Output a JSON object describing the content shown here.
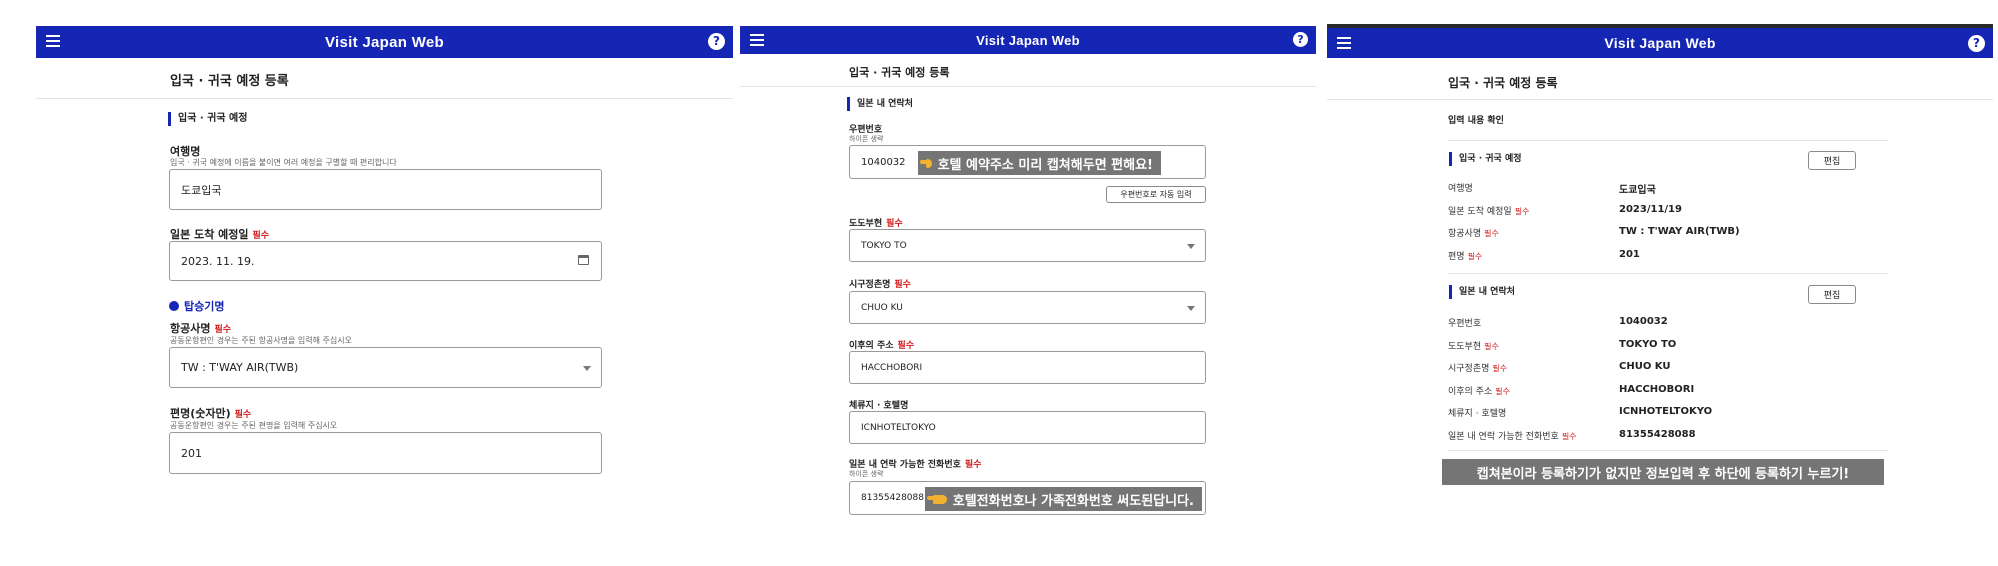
{
  "app_title": "Visit Japan Web",
  "page_title": "입국 · 귀국 예정 등록",
  "required_label": "필수",
  "screen1": {
    "section_title": "입국 · 귀국 예정",
    "trip_name": {
      "label": "여행명",
      "hint": "입국 · 귀국 예정에 이름을 붙이면 여러 예정을 구별할 때 편리합니다",
      "value": "도쿄입국"
    },
    "arrival_date": {
      "label": "일본 도착 예정일",
      "value": "2023. 11. 19."
    },
    "flight_section": "탑승기명",
    "airline": {
      "label": "항공사명",
      "hint": "공동운항편인 경우는 주된 항공사명을 입력해 주십시오",
      "value": "TW : T'WAY AIR(TWB)"
    },
    "flight_no": {
      "label": "편명(숫자만)",
      "hint": "공동운항편인 경우는 주된 편명을 입력해 주십시오",
      "value": "201"
    }
  },
  "screen2": {
    "section_title": "일본 내 연락처",
    "postal": {
      "label": "우편번호",
      "hint": "하이픈 생략",
      "value": "1040032"
    },
    "postal_callout": "호텔 예약주소 미리 캡쳐해두면 편해요!",
    "auto_input_button": "우편번호로 자동 입력",
    "prefecture": {
      "label": "도도부현",
      "value": "TOKYO TO"
    },
    "city": {
      "label": "시구정촌명",
      "value": "CHUO KU"
    },
    "address": {
      "label": "이후의 주소",
      "value": "HACCHOBORI"
    },
    "hotel": {
      "label": "체류지 · 호텔명",
      "value": "ICNHOTELTOKYO"
    },
    "phone": {
      "label": "일본 내 연락 가능한 전화번호",
      "hint": "하이픈 생략",
      "value": "81355428088"
    },
    "phone_callout": "호텔전화번호나 가족전화번호 써도된답니다."
  },
  "screen3": {
    "confirm_title": "입력 내용 확인",
    "edit_label": "편집",
    "section1_title": "입국 · 귀국 예정",
    "section1_rows": [
      {
        "label": "여행명",
        "required": false,
        "value": "도쿄입국"
      },
      {
        "label": "일본 도착 예정일",
        "required": true,
        "value": "2023/11/19"
      },
      {
        "label": "항공사명",
        "required": true,
        "value": "TW : T'WAY AIR(TWB)"
      },
      {
        "label": "편명",
        "required": true,
        "value": "201"
      }
    ],
    "section2_title": "일본 내 연락처",
    "section2_rows": [
      {
        "label": "우편번호",
        "required": false,
        "value": "1040032"
      },
      {
        "label": "도도부현",
        "required": true,
        "value": "TOKYO TO"
      },
      {
        "label": "시구정촌명",
        "required": true,
        "value": "CHUO KU"
      },
      {
        "label": "이후의 주소",
        "required": true,
        "value": "HACCHOBORI"
      },
      {
        "label": "체류지 · 호텔명",
        "required": false,
        "value": "ICNHOTELTOKYO"
      },
      {
        "label": "일본 내 연락 가능한 전화번호",
        "required": true,
        "value": "81355428088"
      }
    ],
    "bottom_callout": "캡쳐본이라 등록하기가 없지만 정보입력 후 하단에 등록하기 누르기!"
  },
  "colors": {
    "header": "#1526b5",
    "required": "#d21b1b",
    "callout": "#757575"
  }
}
